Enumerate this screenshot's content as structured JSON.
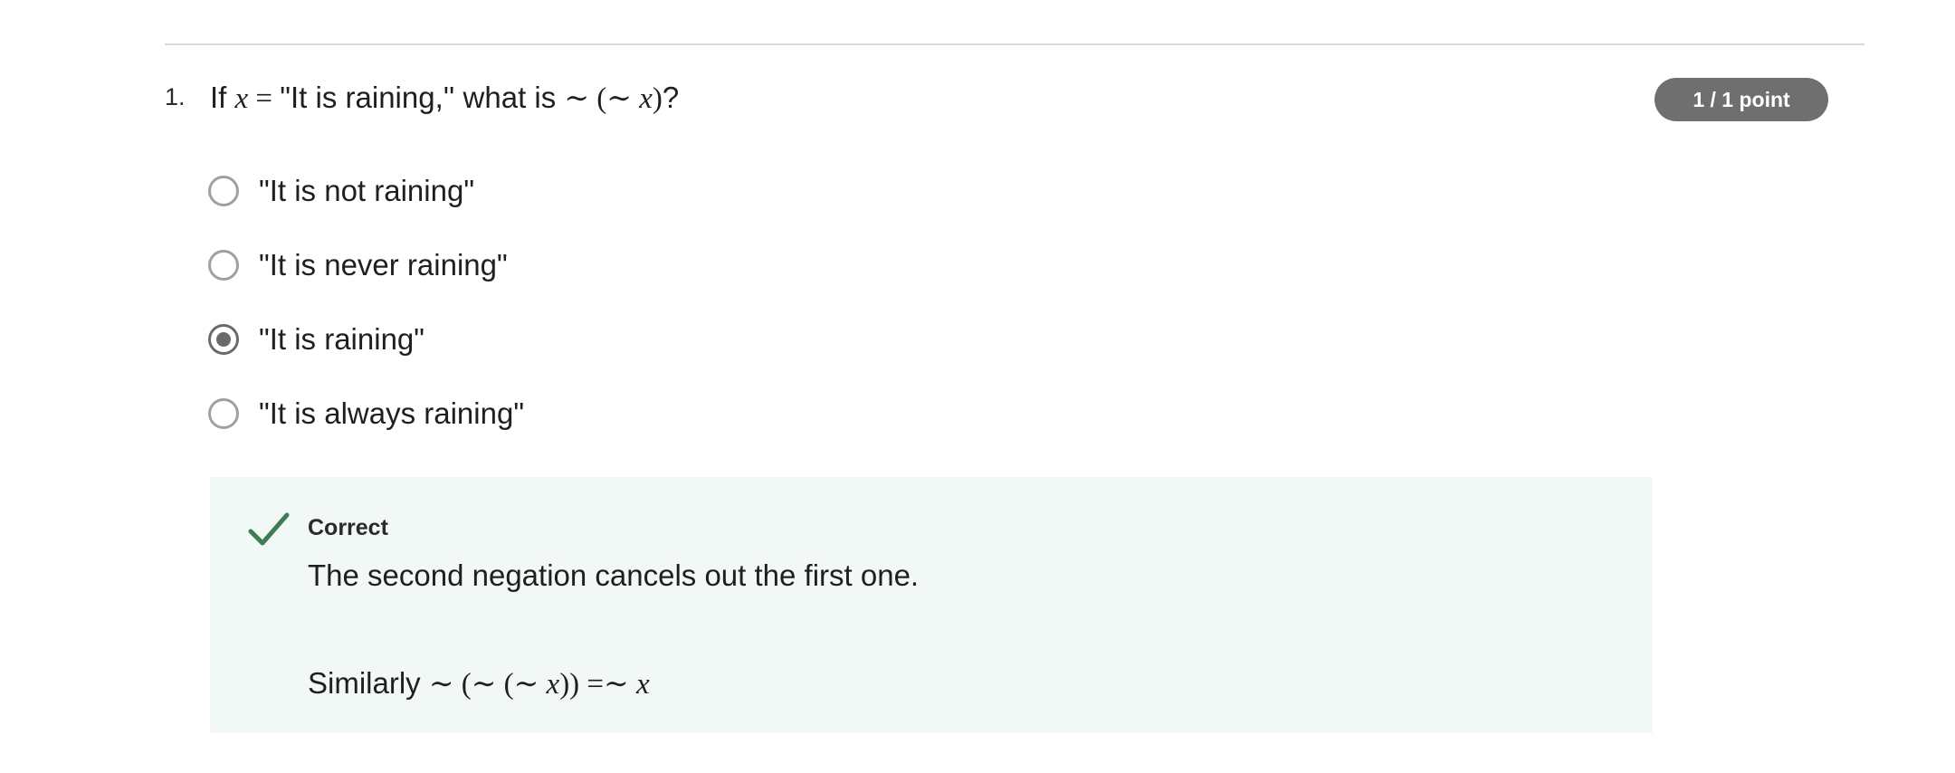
{
  "question": {
    "number": "1.",
    "prefix": "If ",
    "var": "x",
    "equals": " = ",
    "quote": "\"It is raining,''",
    "middle": " what is ",
    "expr": "∼ (∼ ",
    "expr_var": "x",
    "expr_close": ")",
    "suffix": "?",
    "points": "1 / 1 point"
  },
  "options": [
    {
      "label": "\"It is not raining\"",
      "selected": false
    },
    {
      "label": "\"It is never raining\"",
      "selected": false
    },
    {
      "label": "\"It is raining\"",
      "selected": true
    },
    {
      "label": "\"It is always raining\"",
      "selected": false
    }
  ],
  "feedback": {
    "status": "Correct",
    "explanation": "The second negation cancels out the first one.",
    "similar_prefix": "Similarly ",
    "similar_expr_a": "∼ (∼ (∼ ",
    "similar_var_a": "x",
    "similar_expr_b": ")) =∼ ",
    "similar_var_b": "x"
  },
  "colors": {
    "badge": "#6f6f6f",
    "feedback_bg": "#f2f8f6",
    "check": "#3b7d57",
    "radio_selected": "#6a6a6a",
    "radio_border": "#a0a0a0"
  },
  "icons": {
    "check": "check-icon",
    "radio": "radio-icon"
  }
}
